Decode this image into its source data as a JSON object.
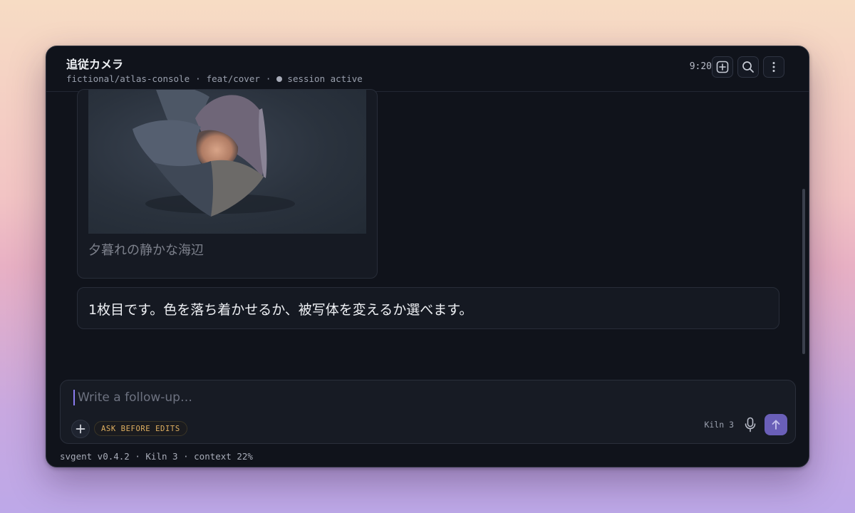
{
  "header": {
    "title": "追従カメラ",
    "repo": "fictional/atlas-console",
    "separator": "·",
    "branch": "feat/cover",
    "session_status": "session active",
    "time": "9:20",
    "icons": [
      "new-chat-icon",
      "search-icon",
      "more-vertical-icon"
    ]
  },
  "messages": {
    "image_caption": "夕暮れの静かな海辺",
    "reply_text": "1枚目です。色を落ち着かせるか、被写体を変えるか選べます。"
  },
  "composer": {
    "placeholder": "Write a follow-up…",
    "value": "",
    "mode_badge": "ASK BEFORE EDITS",
    "model": "Kiln 3",
    "icons": [
      "plus-icon",
      "mic-icon",
      "arrow-up-icon"
    ]
  },
  "footer": {
    "status": "svgent v0.4.2 · Kiln 3 · context 22%"
  },
  "colors": {
    "window_bg": "#10131b",
    "accent": "#6a5fb8",
    "caret": "#8b7cf0",
    "badge_text": "#e0b060"
  }
}
